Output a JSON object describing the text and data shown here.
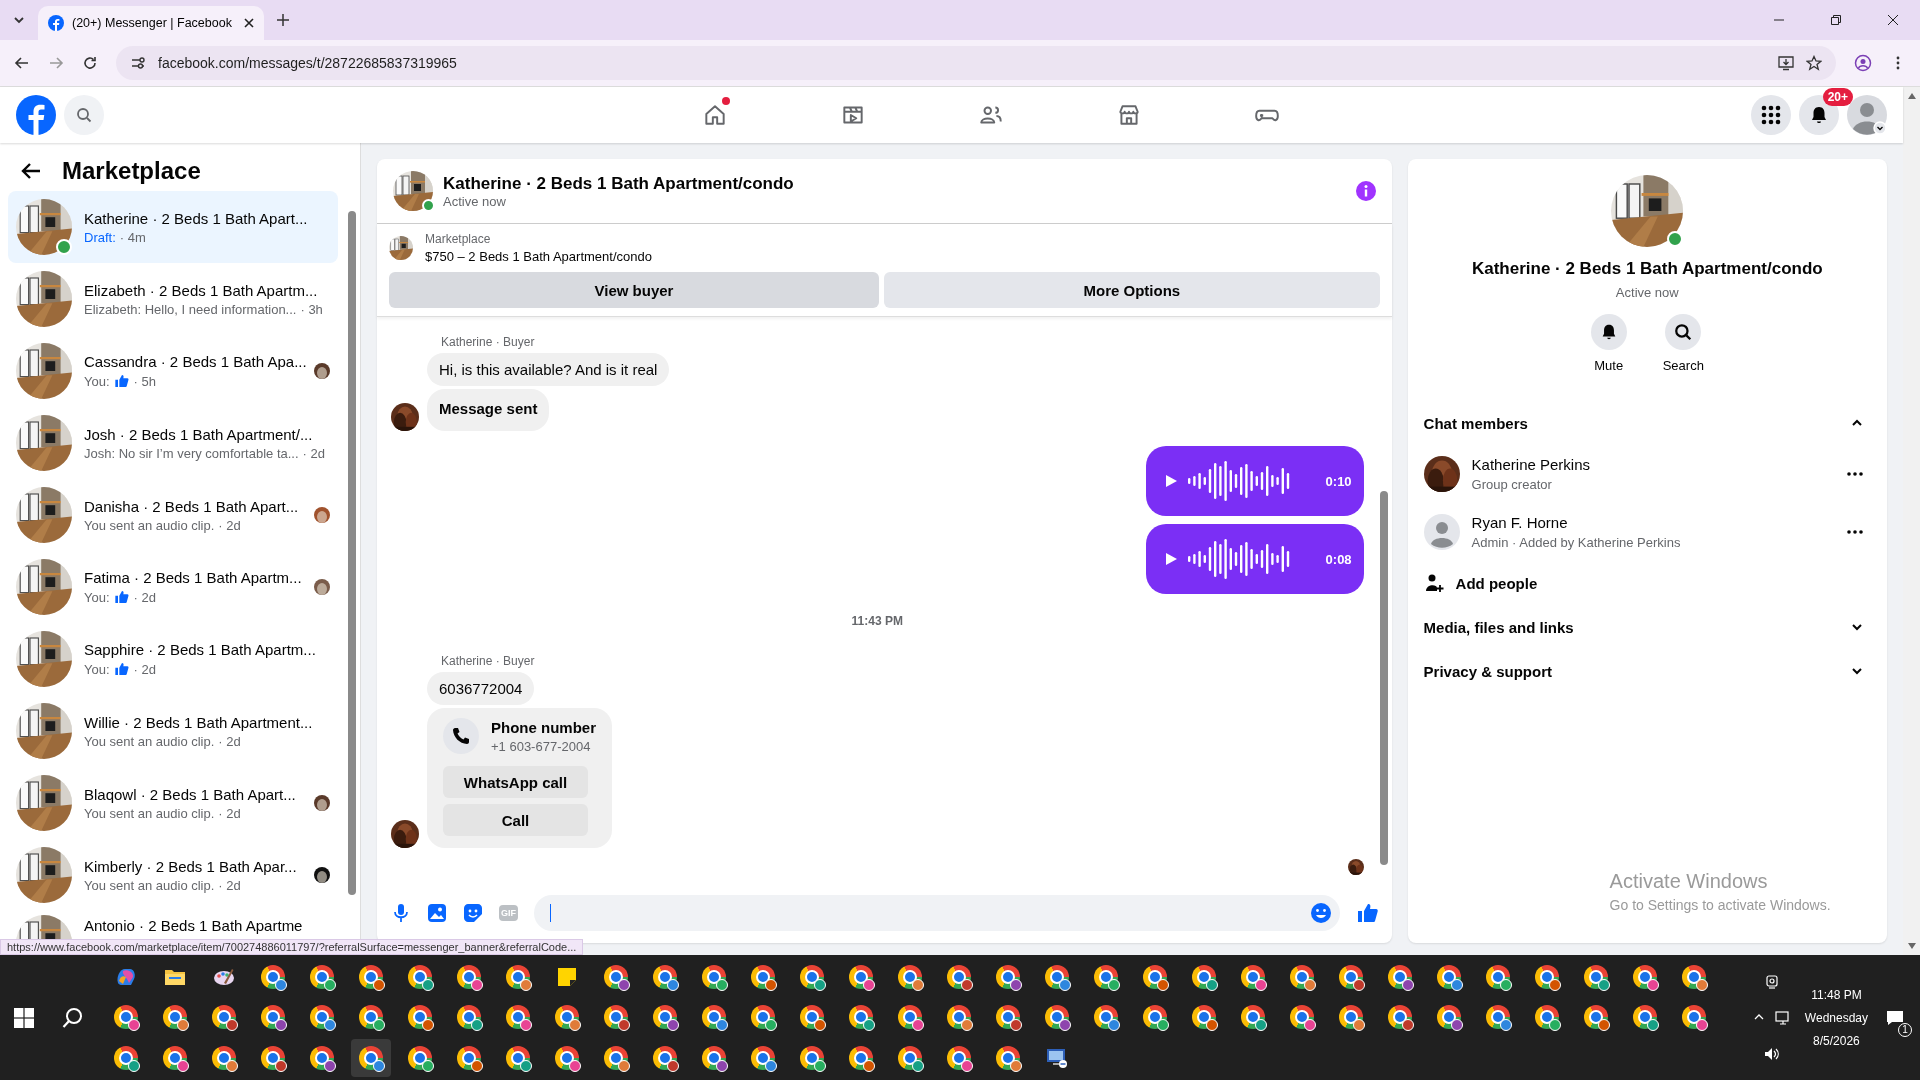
{
  "browser": {
    "tab_title": "(20+) Messenger | Facebook",
    "url": "facebook.com/messages/t/28722685837319965",
    "status_url": "https://www.facebook.com/marketplace/item/700274886011797/?referralSurface=messenger_banner&referralCode..."
  },
  "topnav": {
    "items": [
      {
        "kind": "home",
        "dot": true
      },
      {
        "kind": "video",
        "dot": false
      },
      {
        "kind": "friends",
        "dot": false
      },
      {
        "kind": "market",
        "dot": false
      },
      {
        "kind": "gaming",
        "dot": false
      }
    ],
    "notification_badge": "20+"
  },
  "sidebar": {
    "title": "Marketplace",
    "conversations": [
      {
        "name": "Katherine · 2 Beds 1 Bath Apart...",
        "preview": {
          "kind": "draft",
          "text": "Draft:",
          "time": "· 4m"
        },
        "online": true,
        "seen": false,
        "selected": true
      },
      {
        "name": "Elizabeth · 2 Beds 1 Bath Apartm...",
        "preview": {
          "kind": "text",
          "text": "Elizabeth: Hello, I need information...",
          "time": "· 3h"
        },
        "online": false,
        "seen": false,
        "selected": false
      },
      {
        "name": "Cassandra · 2 Beds 1 Bath Apa...",
        "preview": {
          "kind": "like",
          "text": "You:",
          "time": "· 5h"
        },
        "online": false,
        "seen": true,
        "selected": false
      },
      {
        "name": "Josh · 2 Beds 1 Bath Apartment/...",
        "preview": {
          "kind": "text",
          "text": "Josh: No sir I’m very comfortable ta...",
          "time": "· 2d"
        },
        "online": false,
        "seen": false,
        "selected": false
      },
      {
        "name": "Danisha · 2 Beds 1 Bath Apart...",
        "preview": {
          "kind": "text",
          "text": "You sent an audio clip.",
          "time": "· 2d"
        },
        "online": false,
        "seen": true,
        "selected": false
      },
      {
        "name": "Fatima · 2 Beds 1 Bath Apartm...",
        "preview": {
          "kind": "like",
          "text": "You:",
          "time": "· 2d"
        },
        "online": false,
        "seen": true,
        "selected": false
      },
      {
        "name": "Sapphire · 2 Beds 1 Bath Apartm...",
        "preview": {
          "kind": "like",
          "text": "You:",
          "time": "· 2d"
        },
        "online": false,
        "seen": false,
        "selected": false
      },
      {
        "name": "Willie · 2 Beds 1 Bath Apartment...",
        "preview": {
          "kind": "text",
          "text": "You sent an audio clip.",
          "time": "· 2d"
        },
        "online": false,
        "seen": false,
        "selected": false
      },
      {
        "name": "Blaqowl · 2 Beds 1 Bath Apart...",
        "preview": {
          "kind": "text",
          "text": "You sent an audio clip.",
          "time": "· 2d"
        },
        "online": false,
        "seen": true,
        "selected": false
      },
      {
        "name": "Kimberly · 2 Beds 1 Bath Apar...",
        "preview": {
          "kind": "text",
          "text": "You sent an audio clip.",
          "time": "· 2d"
        },
        "online": false,
        "seen": true,
        "selected": false
      },
      {
        "name": "Antonio · 2 Beds 1 Bath Apartme",
        "preview": {
          "kind": "none"
        },
        "online": false,
        "seen": false,
        "selected": false
      }
    ]
  },
  "chat": {
    "title": "Katherine · 2 Beds 1 Bath Apartment/condo",
    "status": "Active now",
    "online": true,
    "listing": {
      "label": "Marketplace",
      "text": "$750 – 2 Beds 1 Bath Apartment/condo"
    },
    "buttons": [
      {
        "label": "View buyer",
        "selected": true
      },
      {
        "label": "More Options",
        "selected": false
      }
    ],
    "messages": [
      {
        "kind": "sender",
        "text": "Katherine · Buyer"
      },
      {
        "kind": "incoming",
        "text": "Hi, is this available? And is it real",
        "bold": false,
        "avatar": false
      },
      {
        "kind": "incoming",
        "text": "Message sent",
        "bold": true,
        "avatar": true
      },
      {
        "kind": "audio",
        "duration": "0:10"
      },
      {
        "kind": "audio",
        "duration": "0:08"
      },
      {
        "kind": "timestamp",
        "text": "11:43 PM"
      },
      {
        "kind": "sender",
        "text": "Katherine · Buyer"
      },
      {
        "kind": "incoming",
        "text": "6036772004",
        "bold": false,
        "avatar": false
      },
      {
        "kind": "phone_card",
        "title": "Phone number",
        "number": "+1 603-677-2004",
        "buttons": [
          "WhatsApp call",
          "Call"
        ],
        "avatar": true
      }
    ],
    "composer": {
      "gif_label": "GIF"
    }
  },
  "details": {
    "title": "Katherine · 2 Beds 1 Bath Apartment/condo",
    "status": "Active now",
    "online": true,
    "actions": [
      {
        "kind": "mute",
        "label": "Mute"
      },
      {
        "kind": "search",
        "label": "Search"
      }
    ],
    "sections": [
      {
        "title": "Chat members",
        "expanded": true,
        "members": [
          {
            "name": "Katherine Perkins",
            "role": "Group creator"
          },
          {
            "name": "Ryan F. Horne",
            "role": "Admin · Added by Katherine Perkins",
            "kind": "default"
          }
        ],
        "add_label": "Add people"
      },
      {
        "title": "Media, files and links",
        "expanded": false
      },
      {
        "title": "Privacy & support",
        "expanded": false
      }
    ]
  },
  "activation": {
    "title": "Activate Windows",
    "text": "Go to Settings to activate Windows."
  },
  "taskbar": {
    "rows": [
      [
        {
          "kind": "copilot"
        },
        {
          "kind": "files"
        },
        {
          "kind": "paint"
        },
        {
          "kind": "browser"
        },
        {
          "kind": "browser"
        },
        {
          "kind": "browser"
        },
        {
          "kind": "browser"
        },
        {
          "kind": "browser"
        },
        {
          "kind": "browser"
        },
        {
          "kind": "sticky"
        },
        {
          "kind": "browser"
        },
        {
          "kind": "browser"
        },
        {
          "kind": "browser"
        },
        {
          "kind": "browser"
        },
        {
          "kind": "browser"
        },
        {
          "kind": "browser"
        },
        {
          "kind": "browser"
        },
        {
          "kind": "browser"
        },
        {
          "kind": "browser"
        },
        {
          "kind": "browser"
        },
        {
          "kind": "browser"
        },
        {
          "kind": "browser"
        },
        {
          "kind": "browser"
        },
        {
          "kind": "browser"
        },
        {
          "kind": "browser"
        },
        {
          "kind": "browser"
        },
        {
          "kind": "browser"
        },
        {
          "kind": "browser"
        },
        {
          "kind": "browser"
        },
        {
          "kind": "browser"
        },
        {
          "kind": "browser"
        },
        {
          "kind": "browser"
        },
        {
          "kind": "browser"
        }
      ],
      [
        {
          "kind": "browser"
        },
        {
          "kind": "browser"
        },
        {
          "kind": "browser"
        },
        {
          "kind": "browser"
        },
        {
          "kind": "browser"
        },
        {
          "kind": "browser"
        },
        {
          "kind": "browser"
        },
        {
          "kind": "browser"
        },
        {
          "kind": "browser"
        },
        {
          "kind": "browser"
        },
        {
          "kind": "browser"
        },
        {
          "kind": "browser"
        },
        {
          "kind": "browser"
        },
        {
          "kind": "browser"
        },
        {
          "kind": "browser"
        },
        {
          "kind": "browser"
        },
        {
          "kind": "browser"
        },
        {
          "kind": "browser"
        },
        {
          "kind": "browser"
        },
        {
          "kind": "browser"
        },
        {
          "kind": "browser"
        },
        {
          "kind": "browser"
        },
        {
          "kind": "browser"
        },
        {
          "kind": "browser"
        },
        {
          "kind": "browser"
        },
        {
          "kind": "browser"
        },
        {
          "kind": "browser"
        },
        {
          "kind": "browser"
        },
        {
          "kind": "browser"
        },
        {
          "kind": "browser"
        },
        {
          "kind": "browser"
        },
        {
          "kind": "browser"
        },
        {
          "kind": "browser"
        }
      ],
      [
        {
          "kind": "browser"
        },
        {
          "kind": "browser"
        },
        {
          "kind": "browser"
        },
        {
          "kind": "browser"
        },
        {
          "kind": "browser"
        },
        {
          "kind": "browser_active"
        },
        {
          "kind": "browser"
        },
        {
          "kind": "browser"
        },
        {
          "kind": "browser"
        },
        {
          "kind": "browser"
        },
        {
          "kind": "browser"
        },
        {
          "kind": "browser"
        },
        {
          "kind": "browser"
        },
        {
          "kind": "browser"
        },
        {
          "kind": "browser"
        },
        {
          "kind": "browser"
        },
        {
          "kind": "browser"
        },
        {
          "kind": "browser"
        },
        {
          "kind": "browser"
        },
        {
          "kind": "remote"
        }
      ]
    ],
    "time": "11:48 PM",
    "day": "Wednesday",
    "date": "8/5/2026",
    "notifications": "1"
  }
}
